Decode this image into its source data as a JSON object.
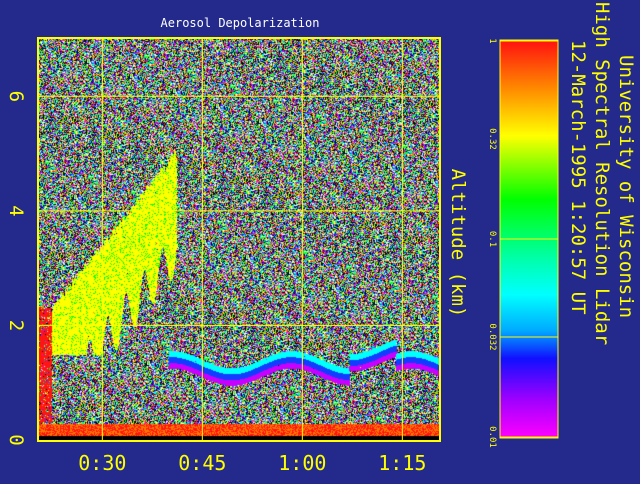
{
  "chart_data": {
    "type": "heatmap",
    "title": "Aerosol Depolarization",
    "xlabel": "",
    "ylabel": "Altitude (km)",
    "x_ticks": [
      "0:30",
      "0:45",
      "1:00",
      "1:15"
    ],
    "x_tick_minutes": [
      30,
      45,
      60,
      75
    ],
    "xlim_minutes": [
      20.5,
      80.5
    ],
    "y_ticks": [
      "0",
      "2",
      "4",
      "6"
    ],
    "y_tick_values": [
      0,
      2,
      4,
      6
    ],
    "ylim": [
      0,
      7
    ],
    "grid": true,
    "colorscale": "log",
    "colorbar_ticks": [
      "1",
      "0.32",
      "0.1",
      "0.032",
      "0.01"
    ],
    "colorbar_values": [
      1,
      0.32,
      0.1,
      0.032,
      0.01
    ],
    "colorbar_range": [
      0.01,
      1
    ],
    "features": [
      {
        "name": "aerosol layer (high depolarization)",
        "minutes": [
          22,
          41
        ],
        "altitude_km": [
          1.5,
          4.9
        ],
        "value": 0.4
      },
      {
        "name": "low cloud / boundary layer top",
        "minutes": [
          40,
          80.5
        ],
        "altitude_km": [
          1.0,
          1.7
        ],
        "value": 0.03
      },
      {
        "name": "surface return",
        "minutes": [
          20.5,
          80.5
        ],
        "altitude_km": [
          0,
          0.25
        ],
        "value": 1.0
      }
    ]
  },
  "header": {
    "institution": "University of Wisconsin",
    "instrument": "High Spectral Resolution Lidar",
    "datetime": "12-March-1995  1:20:57 UT"
  },
  "colors": {
    "background": "#232a8c",
    "frame": "#ffff00",
    "grid": "#ffff00",
    "text": "#ffff00",
    "title_text": "#ffffff"
  }
}
